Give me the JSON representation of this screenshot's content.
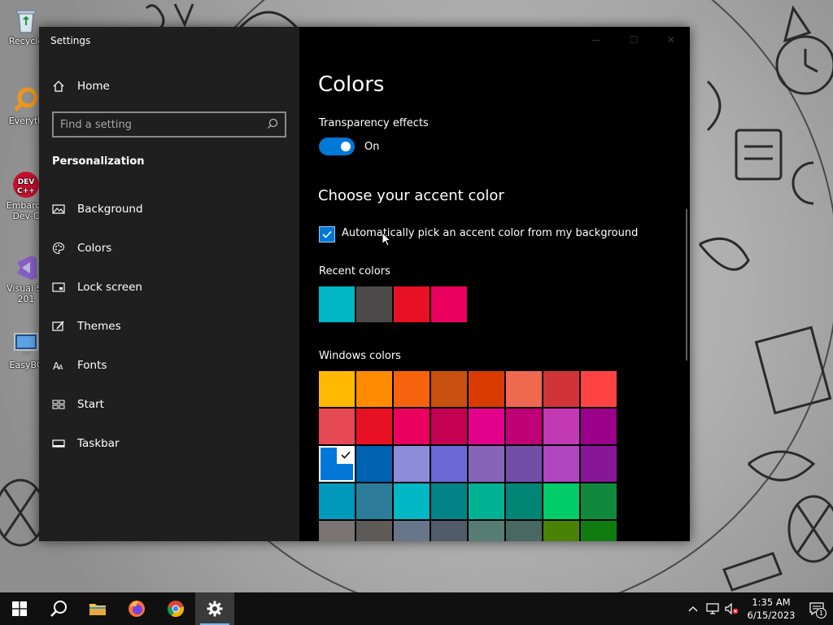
{
  "desktop": {
    "icons": [
      {
        "label": "Recycle",
        "icon": "recycle-bin-icon"
      },
      {
        "label": "Everyth",
        "icon": "everything-search-icon"
      },
      {
        "label": "Embarca Dev-C",
        "icon": "dev-cpp-icon"
      },
      {
        "label": "Visual St 201",
        "icon": "visual-studio-icon"
      },
      {
        "label": "EasyBC",
        "icon": "easybcd-icon"
      }
    ]
  },
  "window": {
    "title": "Settings",
    "controls": {
      "minimize": "—",
      "maximize": "☐",
      "close": "✕"
    }
  },
  "nav": {
    "home_label": "Home",
    "search_placeholder": "Find a setting",
    "section": "Personalization",
    "items": [
      {
        "label": "Background",
        "icon": "picture-icon"
      },
      {
        "label": "Colors",
        "icon": "palette-icon",
        "active": true
      },
      {
        "label": "Lock screen",
        "icon": "lock-screen-icon"
      },
      {
        "label": "Themes",
        "icon": "brush-icon"
      },
      {
        "label": "Fonts",
        "icon": "fonts-icon"
      },
      {
        "label": "Start",
        "icon": "start-grid-icon"
      },
      {
        "label": "Taskbar",
        "icon": "taskbar-icon"
      }
    ]
  },
  "content": {
    "title": "Colors",
    "transparency": {
      "label": "Transparency effects",
      "state": "On"
    },
    "accent_heading": "Choose your accent color",
    "auto_pick": {
      "label": "Automatically pick an accent color from my background",
      "checked": true
    },
    "recent_label": "Recent colors",
    "recent_colors": [
      "#00b7c3",
      "#4c4a48",
      "#e81123",
      "#ea005e"
    ],
    "windows_label": "Windows colors",
    "windows_colors": [
      [
        "#ffb900",
        "#ff8c00",
        "#f7630c",
        "#ca5010",
        "#da3b01",
        "#ef6950",
        "#d13438",
        "#ff4343"
      ],
      [
        "#e74856",
        "#e81123",
        "#ea005e",
        "#c30052",
        "#e3008c",
        "#bf0077",
        "#c239b3",
        "#9a0089"
      ],
      [
        "#0078d7",
        "#0063b1",
        "#8e8cd8",
        "#6b69d6",
        "#8764b8",
        "#744da9",
        "#b146c2",
        "#881798"
      ],
      [
        "#0099bc",
        "#2d7d9a",
        "#00b7c3",
        "#038387",
        "#00b294",
        "#018574",
        "#00cc6a",
        "#10893e"
      ],
      [
        "#7a7574",
        "#5d5a58",
        "#68768a",
        "#515c6b",
        "#567c73",
        "#486860",
        "#498205",
        "#107c10"
      ]
    ],
    "selected_color": "#0078d7"
  },
  "taskbar": {
    "apps": [
      {
        "name": "start-button",
        "icon": "windows-logo-icon"
      },
      {
        "name": "search-button",
        "icon": "search-icon"
      },
      {
        "name": "file-explorer-button",
        "icon": "folder-icon"
      },
      {
        "name": "firefox-button",
        "icon": "firefox-icon"
      },
      {
        "name": "chrome-button",
        "icon": "chrome-icon"
      },
      {
        "name": "settings-button",
        "icon": "gear-icon",
        "active": true
      }
    ],
    "time": "1:35 AM",
    "date": "6/15/2023",
    "notification_count": "1"
  }
}
